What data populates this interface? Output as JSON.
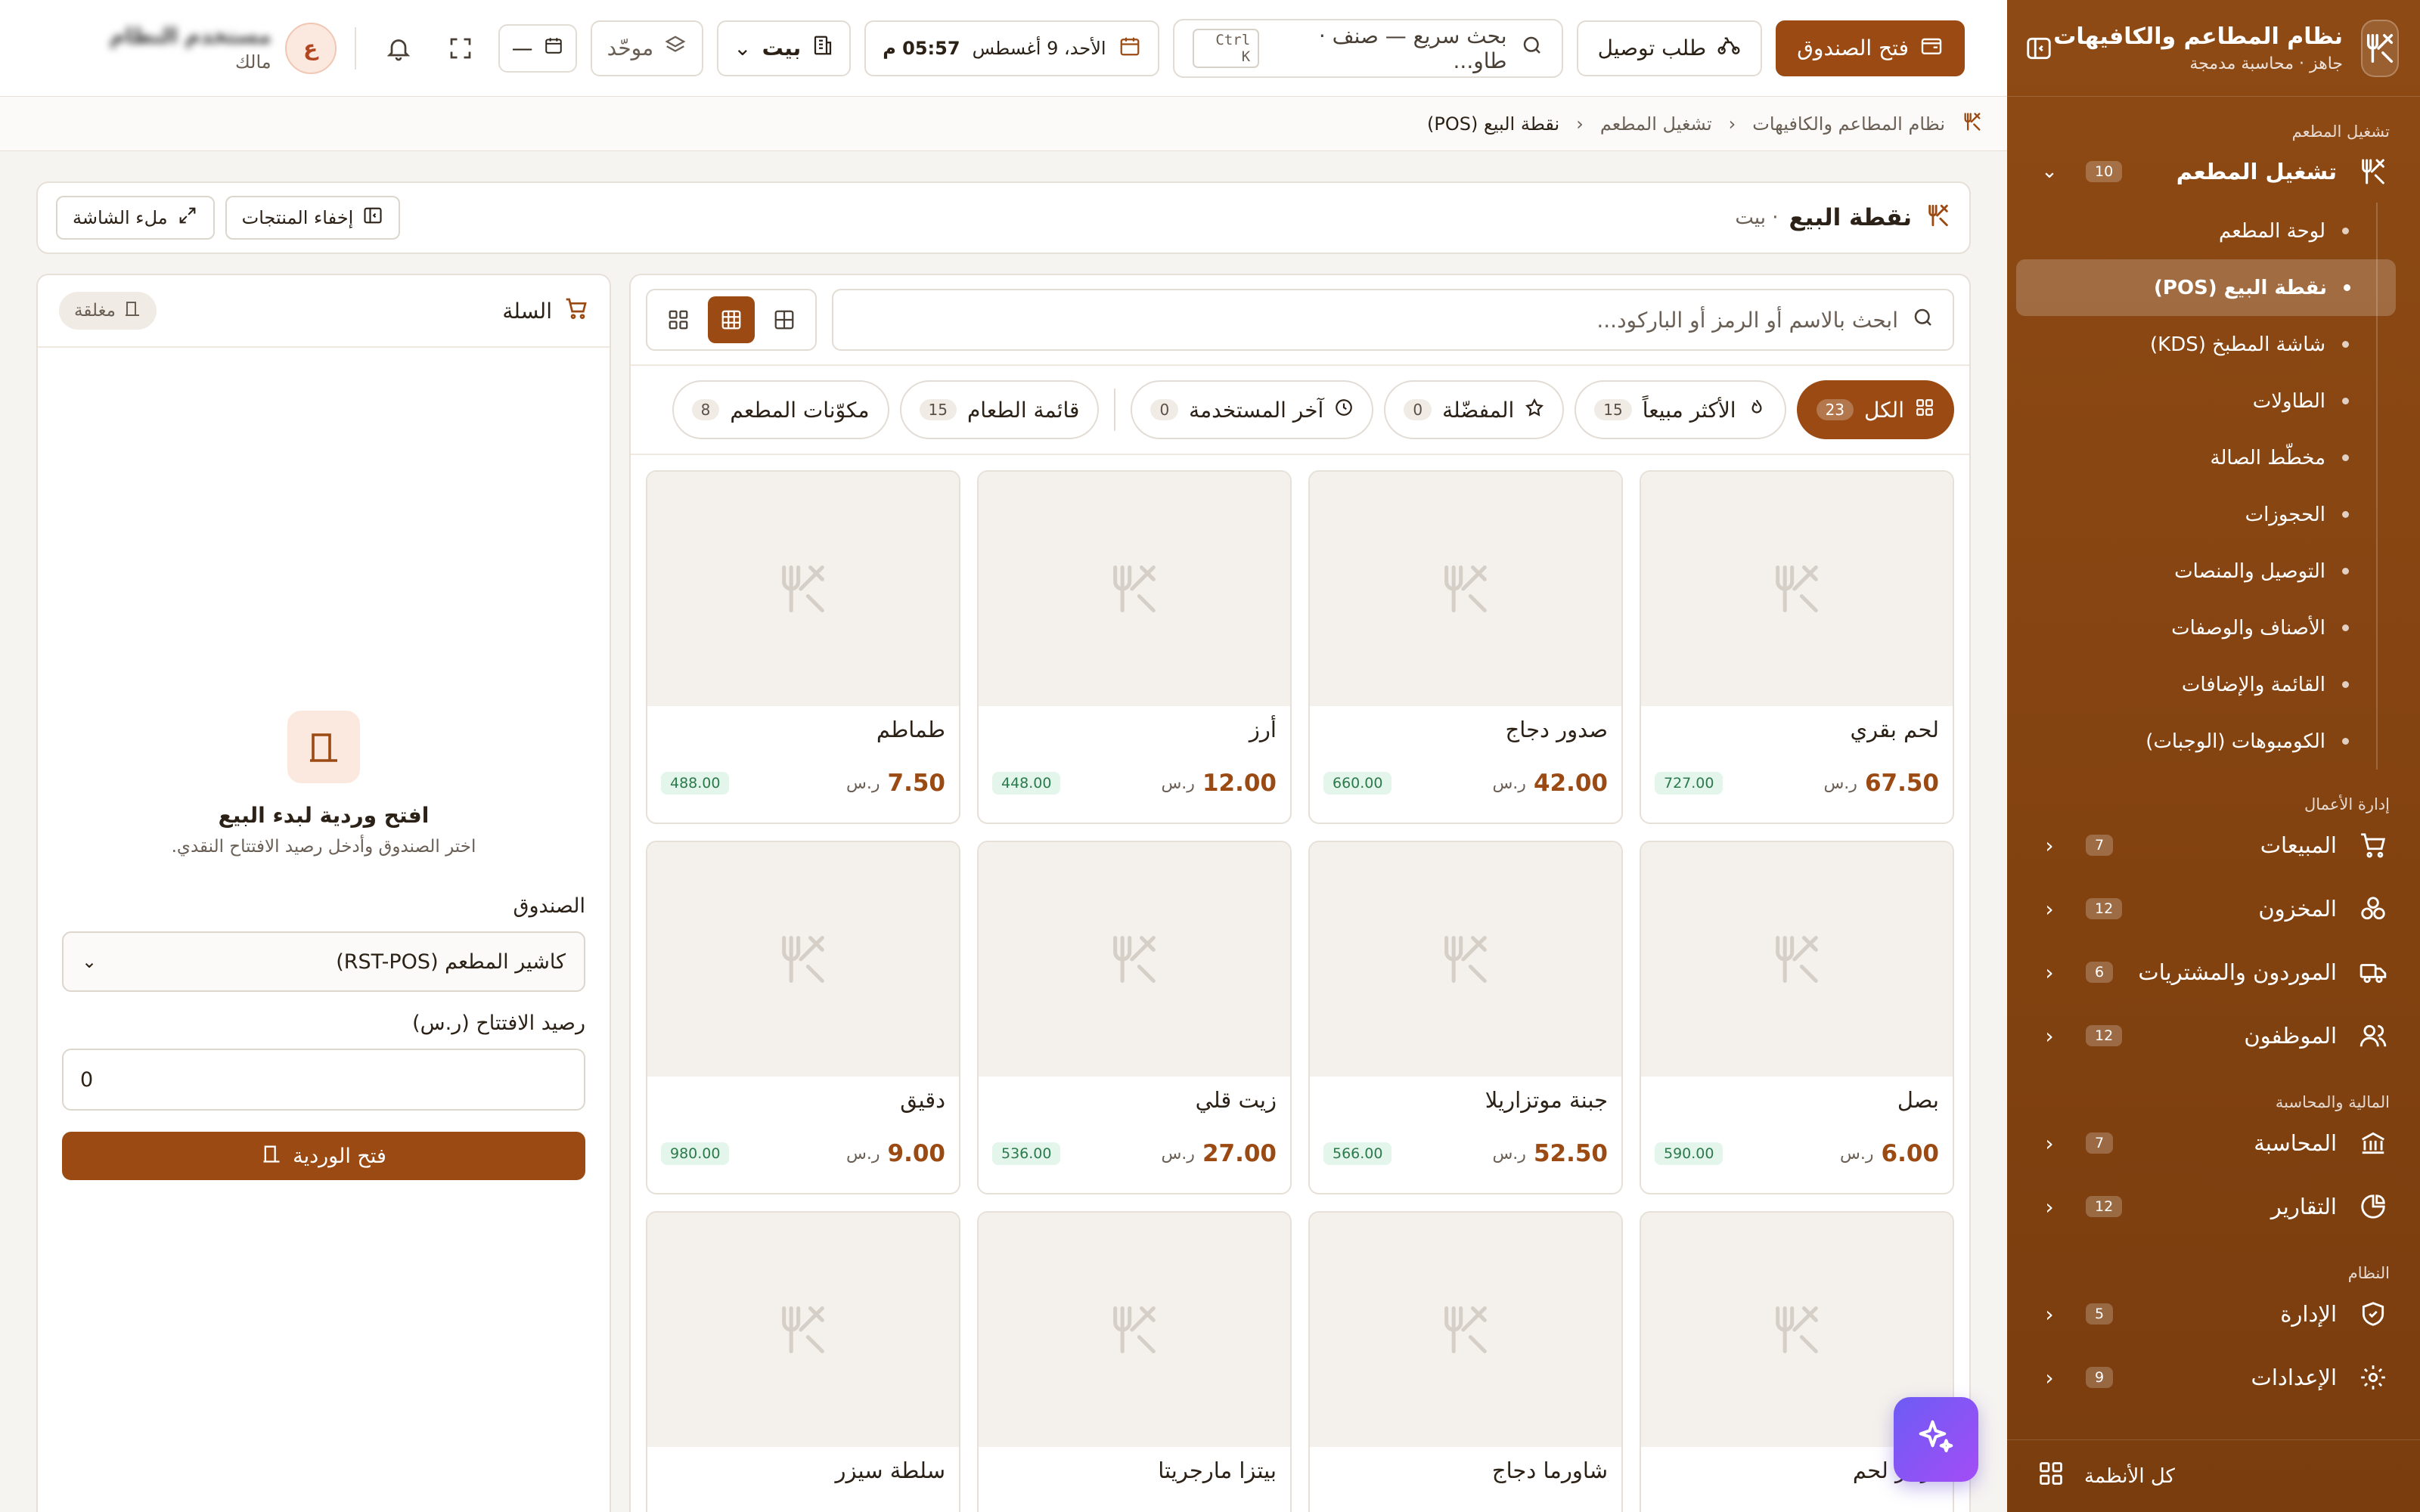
{
  "sidebar": {
    "brand_title": "نظام المطاعم والكافيهات",
    "brand_subtitle": "جاهز · محاسبة مدمجة",
    "section_ops": "تشغيل المطعم",
    "ops_group": {
      "label": "تشغيل المطعم",
      "count": "10"
    },
    "ops_items": [
      {
        "label": "لوحة المطعم"
      },
      {
        "label": "نقطة البيع (POS)"
      },
      {
        "label": "شاشة المطبخ (KDS)"
      },
      {
        "label": "الطاولات"
      },
      {
        "label": "مخطّط الصالة"
      },
      {
        "label": "الحجوزات"
      },
      {
        "label": "التوصيل والمنصات"
      },
      {
        "label": "الأصناف والوصفات"
      },
      {
        "label": "القائمة والإضافات"
      },
      {
        "label": "الكومبوهات (الوجبات)"
      }
    ],
    "section_biz": "إدارة الأعمال",
    "biz_items": [
      {
        "label": "المبيعات",
        "count": "7",
        "icon": "cart-icon"
      },
      {
        "label": "المخزون",
        "count": "12",
        "icon": "boxes-icon"
      },
      {
        "label": "الموردون والمشتريات",
        "count": "6",
        "icon": "truck-icon"
      },
      {
        "label": "الموظفون",
        "count": "12",
        "icon": "users-icon"
      }
    ],
    "section_fin": "المالية والمحاسبة",
    "fin_items": [
      {
        "label": "المحاسبة",
        "count": "7",
        "icon": "bank-icon"
      },
      {
        "label": "التقارير",
        "count": "12",
        "icon": "pie-chart-icon"
      }
    ],
    "section_sys": "النظام",
    "sys_items": [
      {
        "label": "الإدارة",
        "count": "5",
        "icon": "shield-icon"
      },
      {
        "label": "الإعدادات",
        "count": "9",
        "icon": "gear-icon"
      }
    ],
    "all_systems": "كل الأنظمة"
  },
  "topbar": {
    "open_drawer": "فتح الصندوق",
    "delivery_order": "طلب توصيل",
    "search_placeholder": "بحث سريع — صنف · طاو...",
    "search_kbd": "Ctrl K",
    "date": "الأحد، 9 أغسطس",
    "time": "05:57 م",
    "branch": "بيت",
    "mode": "موحّد",
    "calendar_short": "—",
    "avatar_letter": "ع",
    "user_name": "مستخدم النظام",
    "user_role": "مالك"
  },
  "breadcrumb": {
    "root": "نظام المطاعم والكافيهات",
    "section": "تشغيل المطعم",
    "current": "نقطة البيع (POS)"
  },
  "pos": {
    "title": "نقطة البيع",
    "subtitle": "· بيت",
    "hide_products": "إخفاء المنتجات",
    "fullscreen": "ملء الشاشة",
    "search_placeholder": "ابحث بالاسم أو الرمز أو الباركود...",
    "categories": [
      {
        "label": "الكل",
        "count": "23"
      },
      {
        "label": "الأكثر مبيعاً",
        "count": "15"
      },
      {
        "label": "المفضّلة",
        "count": "0"
      },
      {
        "label": "آخر المستخدمة",
        "count": "0"
      },
      {
        "label": "قائمة الطعام",
        "count": "15"
      },
      {
        "label": "مكوّنات المطعم",
        "count": "8"
      }
    ],
    "currency": "ر.س",
    "products": [
      {
        "name": "لحم بقري",
        "price": "67.50",
        "stock": "727.00"
      },
      {
        "name": "صدور دجاج",
        "price": "42.00",
        "stock": "660.00"
      },
      {
        "name": "أرز",
        "price": "12.00",
        "stock": "448.00"
      },
      {
        "name": "طماطم",
        "price": "7.50",
        "stock": "488.00"
      },
      {
        "name": "بصل",
        "price": "6.00",
        "stock": "590.00"
      },
      {
        "name": "جبنة موتزاريلا",
        "price": "52.50",
        "stock": "566.00"
      },
      {
        "name": "زيت قلي",
        "price": "27.00",
        "stock": "536.00"
      },
      {
        "name": "دقيق",
        "price": "9.00",
        "stock": "980.00"
      },
      {
        "name": "برجر لحم",
        "price": "",
        "stock": ""
      },
      {
        "name": "شاورما دجاج",
        "price": "",
        "stock": ""
      },
      {
        "name": "بيتزا مارجريتا",
        "price": "",
        "stock": ""
      },
      {
        "name": "سلطة سيزر",
        "price": "",
        "stock": ""
      }
    ]
  },
  "cart": {
    "title": "السلة",
    "status": "مغلقة",
    "shift_title": "افتح وردية لبدء البيع",
    "shift_sub": "اختر الصندوق وأدخل رصيد الافتتاح النقدي.",
    "drawer_label": "الصندوق",
    "drawer_value": "كاشير المطعم (RST-POS)",
    "opening_label": "رصيد الافتتاح (ر.س)",
    "opening_value": "0",
    "open_shift": "فتح الوردية"
  },
  "colors": {
    "accent": "#9a4a12",
    "sidebar": "#8e4a14",
    "stock_bg": "#e4f5ec"
  }
}
